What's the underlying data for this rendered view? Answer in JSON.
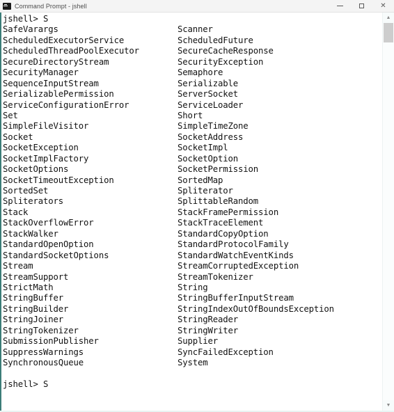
{
  "window": {
    "title": "Command Prompt - jshell",
    "icon": "console-icon",
    "controls": {
      "minimize": "–",
      "maximize": "☐",
      "close": "×"
    }
  },
  "scrollbar": {
    "up_arrow": "▲",
    "down_arrow": "▼",
    "thumb_position_pct": 0
  },
  "console": {
    "prompt_top": "jshell> S",
    "prompt_bottom": "jshell> S",
    "completion_columns": [
      [
        "SafeVarargs",
        "ScheduledExecutorService",
        "ScheduledThreadPoolExecutor",
        "SecureDirectoryStream",
        "SecurityManager",
        "SequenceInputStream",
        "SerializablePermission",
        "ServiceConfigurationError",
        "Set",
        "SimpleFileVisitor",
        "Socket",
        "SocketException",
        "SocketImplFactory",
        "SocketOptions",
        "SocketTimeoutException",
        "SortedSet",
        "Spliterators",
        "Stack",
        "StackOverflowError",
        "StackWalker",
        "StandardOpenOption",
        "StandardSocketOptions",
        "Stream",
        "StreamSupport",
        "StrictMath",
        "StringBuffer",
        "StringBuilder",
        "StringJoiner",
        "StringTokenizer",
        "SubmissionPublisher",
        "SuppressWarnings",
        "SynchronousQueue"
      ],
      [
        "Scanner",
        "ScheduledFuture",
        "SecureCacheResponse",
        "SecurityException",
        "Semaphore",
        "Serializable",
        "ServerSocket",
        "ServiceLoader",
        "Short",
        "SimpleTimeZone",
        "SocketAddress",
        "SocketImpl",
        "SocketOption",
        "SocketPermission",
        "SortedMap",
        "Spliterator",
        "SplittableRandom",
        "StackFramePermission",
        "StackTraceElement",
        "StandardCopyOption",
        "StandardProtocolFamily",
        "StandardWatchEventKinds",
        "StreamCorruptedException",
        "StreamTokenizer",
        "String",
        "StringBufferInputStream",
        "StringIndexOutOfBoundsException",
        "StringReader",
        "StringWriter",
        "Supplier",
        "SyncFailedException",
        "System"
      ]
    ]
  },
  "colors": {
    "text": "#121212",
    "background": "#ffffff",
    "titlebar": "#f4f4f4",
    "left_border": "#3c7d78",
    "scrollbar_thumb": "#cdcdcd"
  }
}
